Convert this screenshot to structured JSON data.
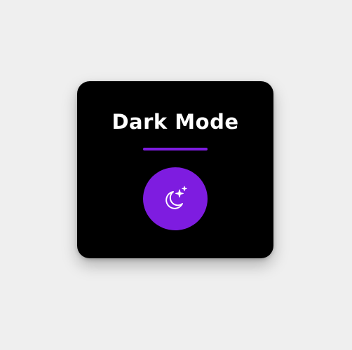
{
  "card": {
    "title": "Dark Mode"
  },
  "toggle": {
    "icon": "moon-stars-icon",
    "state": "dark"
  },
  "colors": {
    "page_background": "#efefef",
    "card_background": "#000000",
    "accent": "#7e1ce0",
    "text": "#ffffff"
  }
}
